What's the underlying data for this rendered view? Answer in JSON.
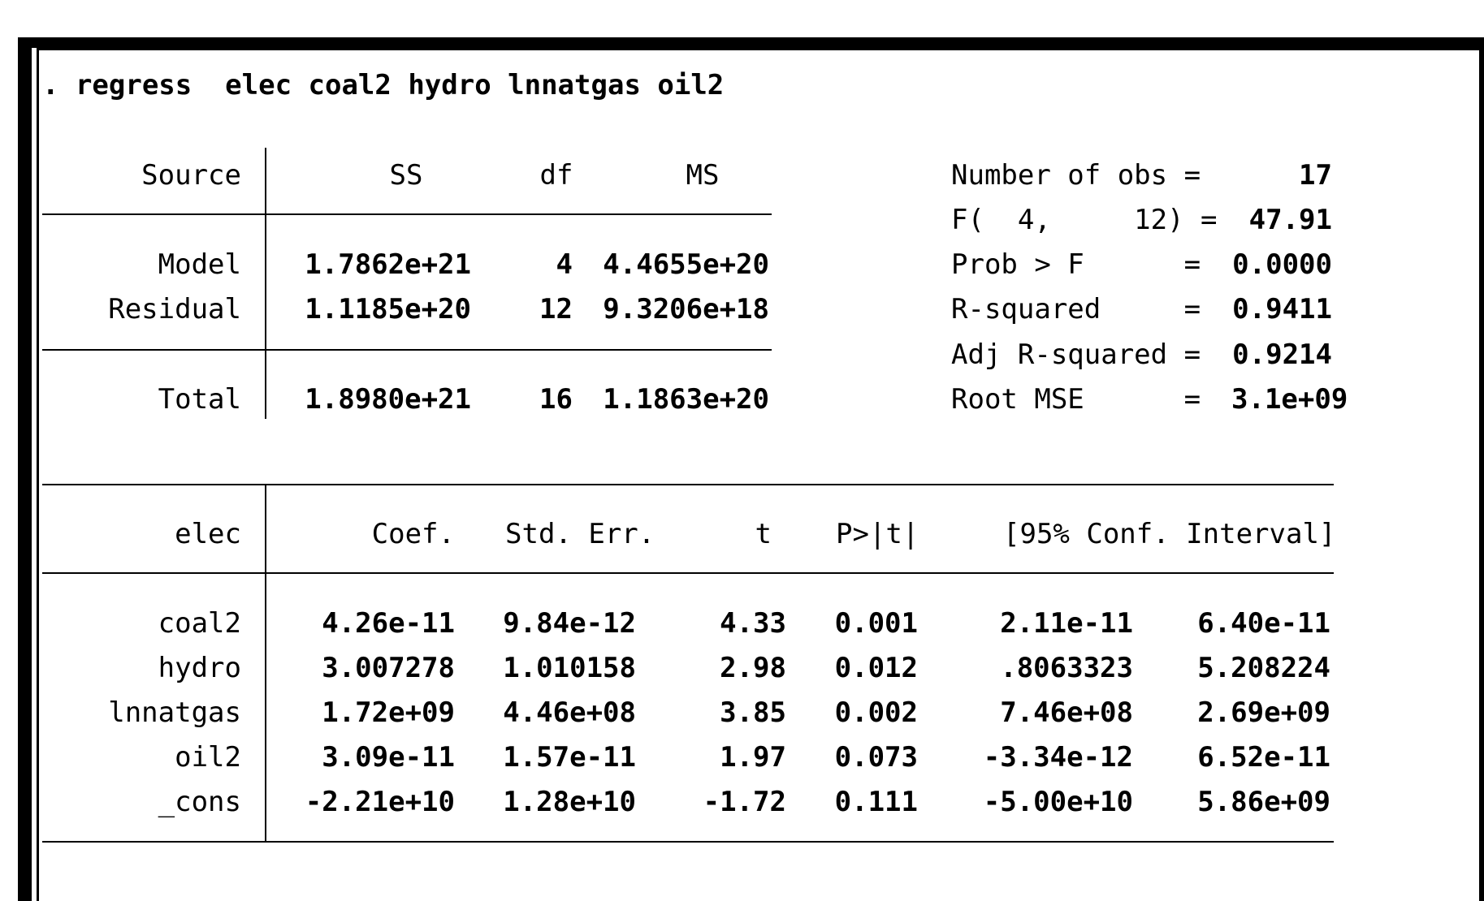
{
  "command": ". regress  elec coal2 hydro lnnatgas oil2",
  "anova": {
    "headers": {
      "source": "Source",
      "ss": "SS",
      "df": "df",
      "ms": "MS"
    },
    "rows": [
      {
        "source": "Model",
        "ss": "1.7862e+21",
        "df": "4",
        "ms": "4.4655e+20"
      },
      {
        "source": "Residual",
        "ss": "1.1185e+20",
        "df": "12",
        "ms": "9.3206e+18"
      },
      {
        "source": "Total",
        "ss": "1.8980e+21",
        "df": "16",
        "ms": "1.1863e+20"
      }
    ]
  },
  "stats": [
    {
      "label": "Number of obs =",
      "value": "17"
    },
    {
      "label": "F(  4,     12) =",
      "value": "47.91"
    },
    {
      "label": "Prob > F      =",
      "value": "0.0000"
    },
    {
      "label": "R-squared     =",
      "value": "0.9411"
    },
    {
      "label": "Adj R-squared =",
      "value": "0.9214"
    },
    {
      "label": "Root MSE      =",
      "value": "3.1e+09"
    }
  ],
  "coef": {
    "headers": {
      "var": "elec",
      "coef": "Coef.",
      "se": "Std. Err.",
      "t": "t",
      "p": "P>|t|",
      "ci": "[95% Conf. Interval]"
    },
    "rows": [
      {
        "var": "coal2",
        "coef": "4.26e-11",
        "se": "9.84e-12",
        "t": "4.33",
        "p": "0.001",
        "lo": "2.11e-11",
        "hi": "6.40e-11"
      },
      {
        "var": "hydro",
        "coef": "3.007278",
        "se": "1.010158",
        "t": "2.98",
        "p": "0.012",
        "lo": ".8063323",
        "hi": "5.208224"
      },
      {
        "var": "lnnatgas",
        "coef": "1.72e+09",
        "se": "4.46e+08",
        "t": "3.85",
        "p": "0.002",
        "lo": "7.46e+08",
        "hi": "2.69e+09"
      },
      {
        "var": "oil2",
        "coef": "3.09e-11",
        "se": "1.57e-11",
        "t": "1.97",
        "p": "0.073",
        "lo": "-3.34e-12",
        "hi": "6.52e-11"
      },
      {
        "var": "_cons",
        "coef": "-2.21e+10",
        "se": "1.28e+10",
        "t": "-1.72",
        "p": "0.111",
        "lo": "-5.00e+10",
        "hi": "5.86e+09"
      }
    ]
  }
}
